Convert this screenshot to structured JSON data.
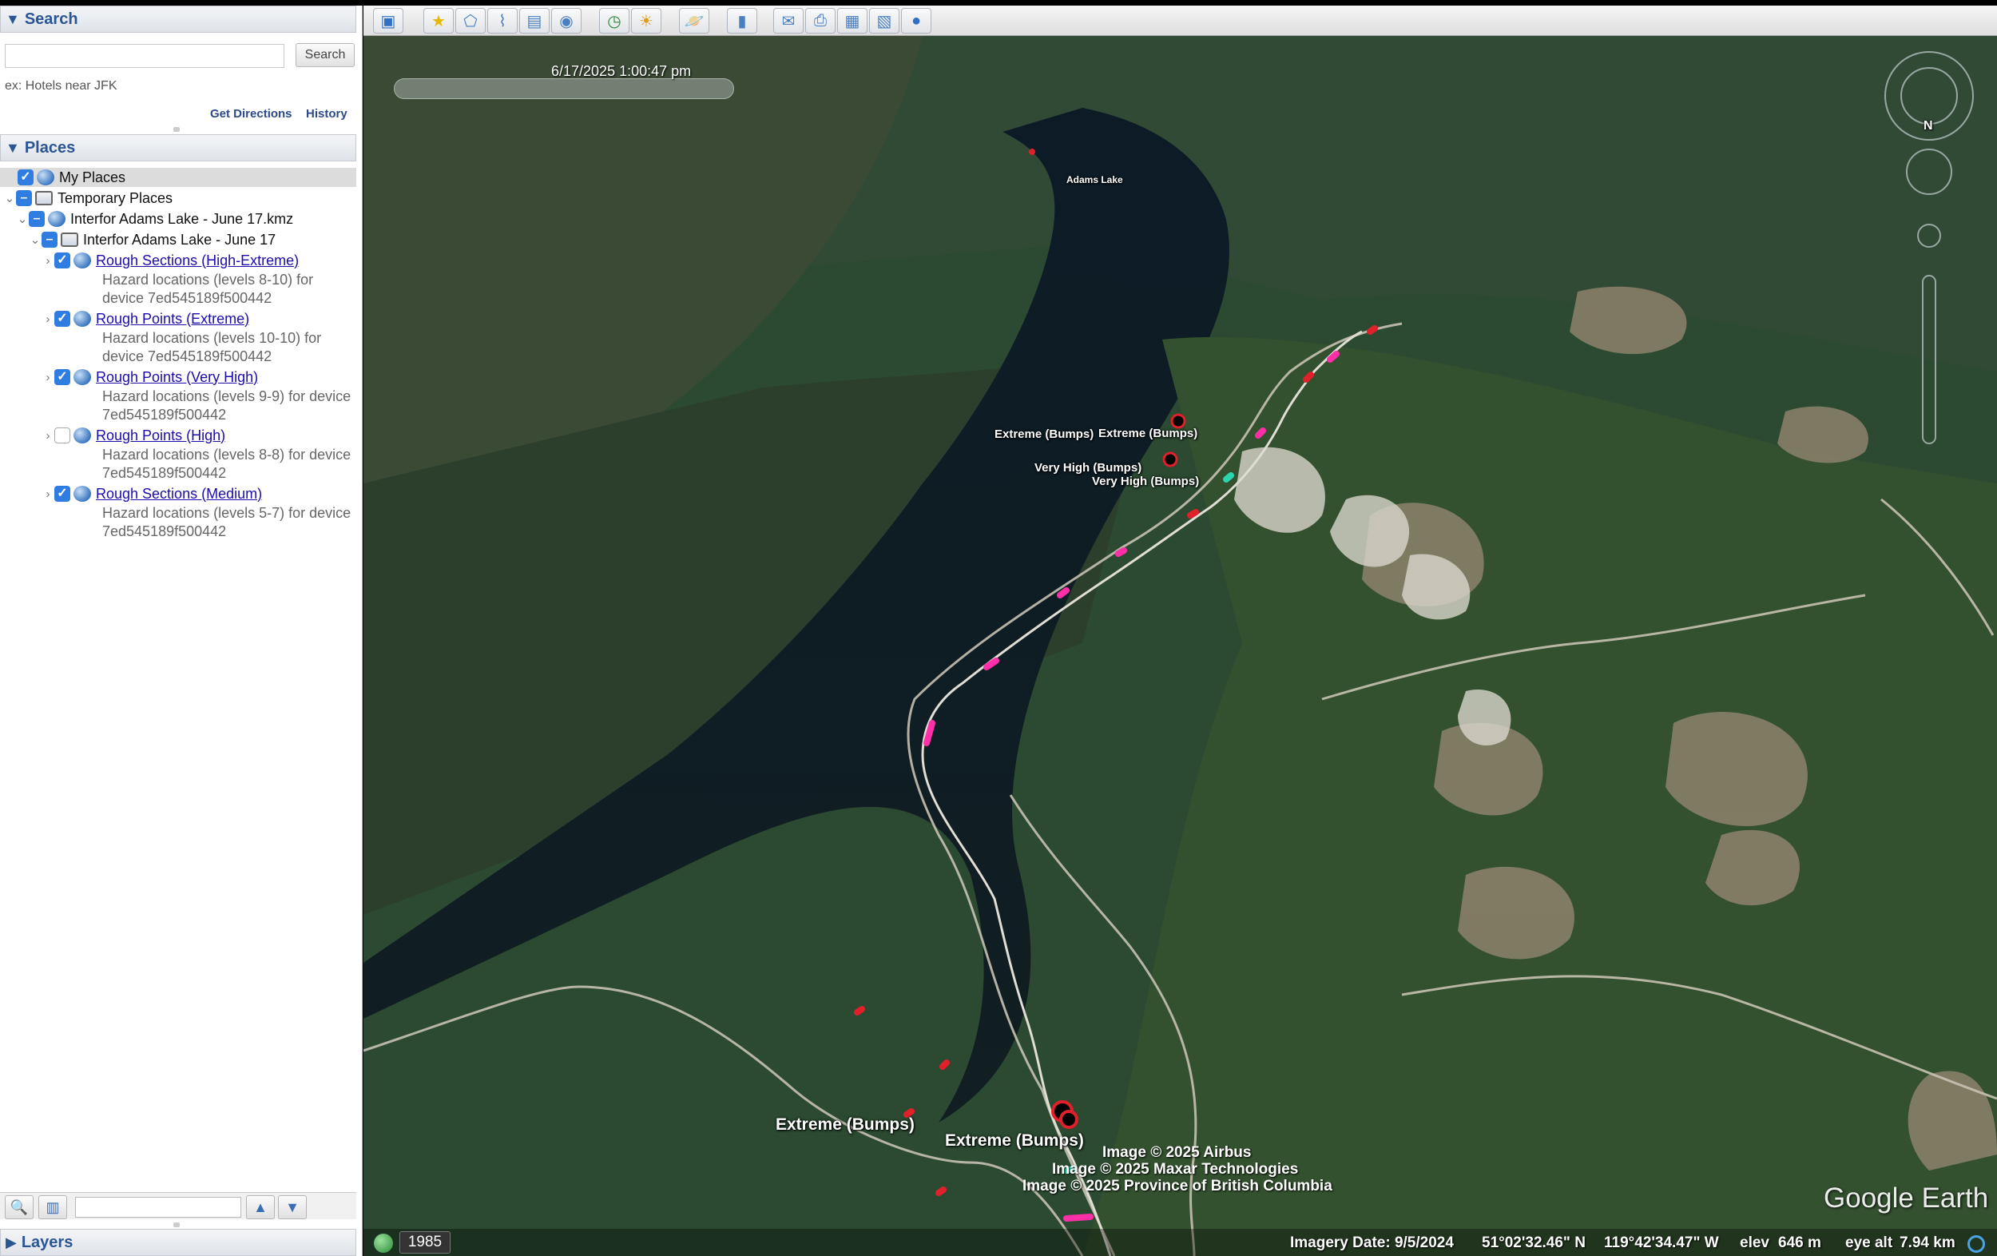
{
  "search_panel": {
    "title": "Search",
    "button": "Search",
    "input_value": "",
    "hint": "ex: Hotels near JFK",
    "get_directions": "Get Directions",
    "history": "History"
  },
  "places_panel": {
    "title": "Places",
    "my_places": "My Places",
    "temporary_places": "Temporary Places",
    "kmz": "Interfor Adams Lake - June 17.kmz",
    "folder": "Interfor Adams Lake - June 17",
    "layers": [
      {
        "name": "Rough Sections (High-Extreme)",
        "desc": "Hazard locations (levels 8-10) for device 7ed545189f500442",
        "checked": true
      },
      {
        "name": "Rough Points (Extreme)",
        "desc": "Hazard locations (levels 10-10) for device 7ed545189f500442",
        "checked": true
      },
      {
        "name": "Rough Points (Very High)",
        "desc": "Hazard locations (levels 9-9) for device 7ed545189f500442",
        "checked": true
      },
      {
        "name": "Rough Points (High)",
        "desc": "Hazard locations (levels 8-8) for device 7ed545189f500442",
        "checked": false
      },
      {
        "name": "Rough Sections (Medium)",
        "desc": "Hazard locations (levels 5-7) for device 7ed545189f500442",
        "checked": true
      }
    ]
  },
  "layers_panel": {
    "title": "Layers"
  },
  "map": {
    "timestamp": "6/17/2025  1:00:47 pm",
    "place_label": "Adams Lake",
    "labels": {
      "extreme_small_1": "Extreme (Bumps)",
      "extreme_small_2": "Extreme (Bumps)",
      "very_high_1": "Very High (Bumps)",
      "very_high_2": "Very High (Bumps)",
      "extreme_big_1": "Extreme (Bumps)",
      "extreme_big_2": "Extreme (Bumps)"
    },
    "attribution": [
      "Image © 2025 Airbus",
      "Image © 2025 Maxar Technologies",
      "Image © 2025 Province of British Columbia"
    ],
    "logo": "Google Earth",
    "compass_n": "N"
  },
  "status": {
    "year": "1985",
    "imagery_date": "Imagery Date: 9/5/2024",
    "lat": "51°02'32.46\" N",
    "lon": "119°42'34.47\" W",
    "elev_label": "elev",
    "elev": "646 m",
    "eye_label": "eye alt",
    "eye": "7.94 km"
  },
  "colors": {
    "accent": "#2b5593",
    "route_pink": "#ff2fa8",
    "route_red": "#e0202a",
    "route_teal": "#2ad6b0"
  }
}
